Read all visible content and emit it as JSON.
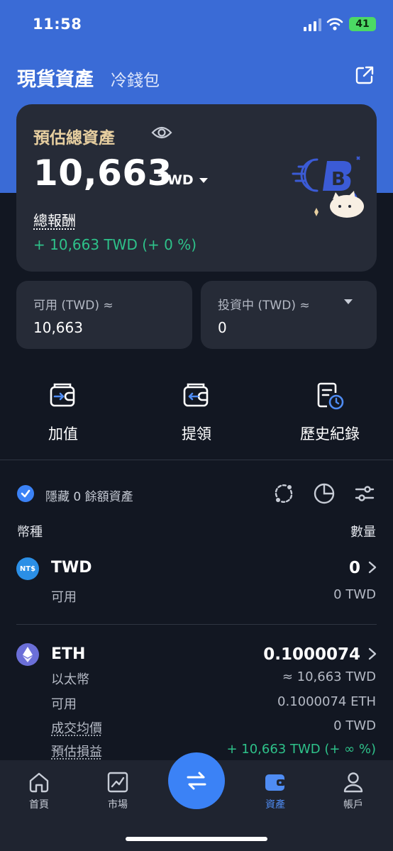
{
  "status": {
    "time": "11:58",
    "battery": "41"
  },
  "header": {
    "title": "現貨資產",
    "subtitle": "冷錢包"
  },
  "summary": {
    "label": "預估總資產",
    "amount": "10,663",
    "currency": "TWD",
    "reward_label": "總報酬",
    "reward_value": "+ 10,663 TWD (+ 0 %)"
  },
  "available": {
    "label": "可用 (TWD) ≈",
    "value": "10,663"
  },
  "investing": {
    "label": "投資中 (TWD) ≈",
    "value": "0"
  },
  "actions": [
    {
      "label": "加值",
      "icon": "deposit-wallet-icon"
    },
    {
      "label": "提領",
      "icon": "withdraw-wallet-icon"
    },
    {
      "label": "歷史紀錄",
      "icon": "history-document-icon"
    }
  ],
  "asset_list": {
    "hide_zero_label": "隱藏 0 餘額資產",
    "col_currency": "幣種",
    "col_quantity": "數量"
  },
  "assets": [
    {
      "symbol": "TWD",
      "icon_text": "NT$",
      "quantity": "0",
      "rows": [
        {
          "label": "可用",
          "value": "0 TWD"
        }
      ]
    },
    {
      "symbol": "ETH",
      "quantity": "0.1000074",
      "rows": [
        {
          "label": "以太幣",
          "value": "≈ 10,663 TWD"
        },
        {
          "label": "可用",
          "value": "0.1000074 ETH"
        },
        {
          "label": "成交均價",
          "value": "0 TWD"
        },
        {
          "label": "預估損益",
          "value": "+ 10,663 TWD (+ ∞ %)"
        }
      ]
    }
  ],
  "tabs": [
    {
      "label": "首頁",
      "icon": "home-icon"
    },
    {
      "label": "市場",
      "icon": "market-chart-icon"
    },
    {
      "label": "資產",
      "icon": "wallet-icon"
    },
    {
      "label": "帳戶",
      "icon": "person-icon"
    }
  ],
  "colors": {
    "brand_blue": "#3a6bd6",
    "accent_blue": "#3b82f6",
    "gain_green": "#2ec28a",
    "label_gold": "#e7cfa0"
  }
}
